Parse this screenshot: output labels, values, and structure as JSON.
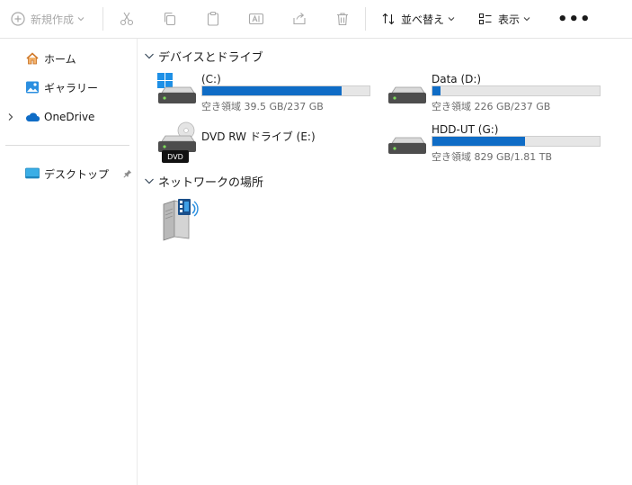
{
  "toolbar": {
    "new_label": "新規作成",
    "sort_label": "並べ替え",
    "view_label": "表示",
    "more_label": "•••"
  },
  "nav": {
    "items": [
      {
        "label": "ホーム"
      },
      {
        "label": "ギャラリー"
      },
      {
        "label": "OneDrive"
      },
      {
        "label": "デスクトップ"
      }
    ]
  },
  "sections": {
    "devices_title": "デバイスとドライブ",
    "network_title": "ネットワークの場所"
  },
  "drives": [
    {
      "name": "(C:)",
      "free_text": "空き領域 39.5 GB/237 GB",
      "used_fraction": 0.834
    },
    {
      "name": "Data (D:)",
      "free_text": "空き領域 226 GB/237 GB",
      "used_fraction": 0.046
    },
    {
      "name": "DVD RW ドライブ (E:)",
      "badge": "DVD"
    },
    {
      "name": "HDD-UT (G:)",
      "free_text": "空き領域 829 GB/1.81 TB",
      "used_fraction": 0.553
    }
  ],
  "colors": {
    "accent": "#0f6cc6",
    "bar_track": "#e6e6e6"
  }
}
